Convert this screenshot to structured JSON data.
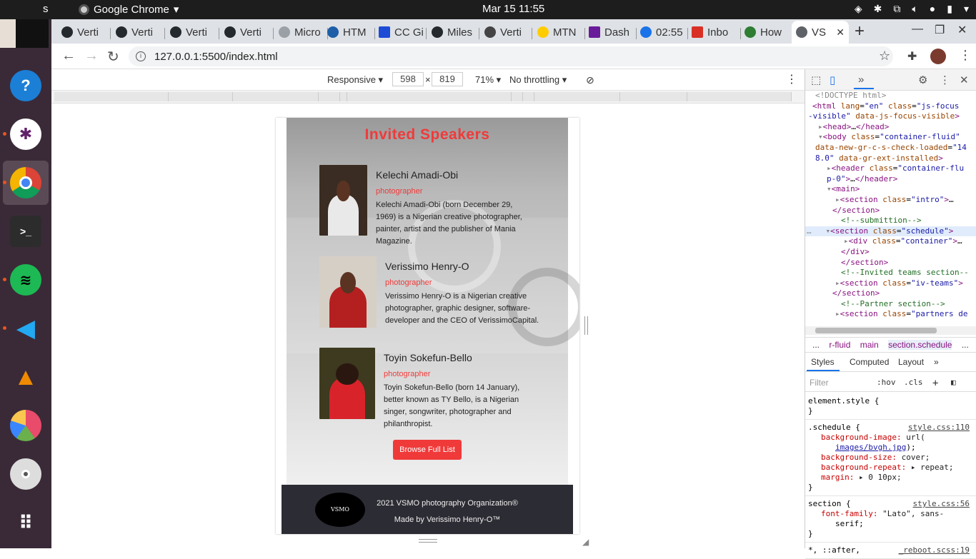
{
  "os": {
    "activities_fragment": "s",
    "active_app": "Google Chrome",
    "clock": "Mar 15  11:55"
  },
  "chrome": {
    "tabs": [
      {
        "label": "Verti",
        "color": "#24292e"
      },
      {
        "label": "Verti",
        "color": "#24292e"
      },
      {
        "label": "Verti",
        "color": "#24292e"
      },
      {
        "label": "Verti",
        "color": "#24292e"
      },
      {
        "label": "Micro",
        "color": "#9aa0a6"
      },
      {
        "label": "HTM",
        "color": "#1f5fa8"
      },
      {
        "label": "CC Gi",
        "color": "#1c4bd6"
      },
      {
        "label": "Miles",
        "color": "#24292e"
      },
      {
        "label": "Verti",
        "color": "#444444"
      },
      {
        "label": "MTN",
        "color": "#ffcc00"
      },
      {
        "label": "Dash",
        "color": "#6a1b9a"
      },
      {
        "label": "02:55",
        "color": "#1a73e8"
      },
      {
        "label": "Inbo",
        "color": "#d93025"
      },
      {
        "label": "How",
        "color": "#2e7d32"
      },
      {
        "label": "VS",
        "color": "#5f6368"
      }
    ],
    "url": "127.0.0.1:5500/index.html"
  },
  "device_toolbar": {
    "mode": "Responsive",
    "width": "598",
    "height": "819",
    "times": "×",
    "zoom": "71%",
    "throttle": "No throttling"
  },
  "page": {
    "title": "Invited Speakers",
    "speakers": [
      {
        "name": "Kelechi Amadi-Obi",
        "role": "photographer",
        "bio": "Kelechi Amadi-Obi (born December 29, 1969) is a Nigerian creative photographer, painter, artist and the publisher of Mania Magazine."
      },
      {
        "name": "Verissimo Henry-O",
        "role": "photographer",
        "bio": "Verissimo Henry-O is a Nigerian creative photographer, graphic designer, software-developer and the CEO of VerissimoCapital."
      },
      {
        "name": "Toyin Sokefun-Bello",
        "role": "photographer",
        "bio": "Toyin Sokefun-Bello (born 14 January), better known as TY Bello, is a Nigerian singer, songwriter, photographer and philanthropist."
      }
    ],
    "browse_button": "Browse Full List",
    "footer": {
      "logo_text": "VSMO",
      "line1": "2021 VSMO photography Organization®",
      "line2": "Made by Verissimo Henry-O™"
    }
  },
  "devtools": {
    "crumbs": [
      "...",
      "r-fluid",
      "main",
      "section.schedule",
      "..."
    ],
    "style_tabs": [
      "Styles",
      "Computed",
      "Layout",
      "»"
    ],
    "filter_placeholder": "Filter",
    "hov": ":hov",
    "cls": ".cls",
    "rules": [
      {
        "selector": "element.style {",
        "source": ""
      },
      {
        "selector": ".schedule {",
        "source": "style.css:110"
      },
      {
        "selector": "section {",
        "source": "style.css:56"
      },
      {
        "selector": "*, ::after,",
        "source": "_reboot.scss:19"
      }
    ]
  }
}
